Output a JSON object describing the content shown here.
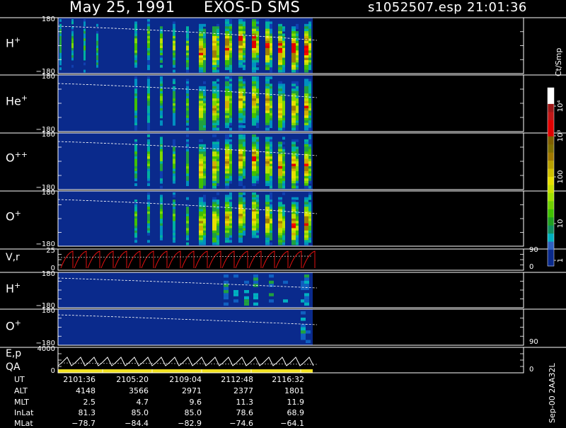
{
  "header": {
    "date": "May 25, 1991",
    "instrument": "EXOS-D SMS",
    "file": "s1052507.esp",
    "time": "21:01:36"
  },
  "chart_data": [
    {
      "type": "heatmap",
      "panel": "H+",
      "ion": "H",
      "charge": "+",
      "y_top": "180",
      "y_bottom": "−180",
      "rows": "energy-angle spectrogram",
      "color_scale": "log Ct/Smp"
    },
    {
      "type": "heatmap",
      "panel": "He+",
      "ion": "He",
      "charge": "+",
      "y_top": "180",
      "y_bottom": "−180"
    },
    {
      "type": "heatmap",
      "panel": "O++",
      "ion": "O",
      "charge": "++",
      "y_top": "180",
      "y_bottom": "−180"
    },
    {
      "type": "heatmap",
      "panel": "O+",
      "ion": "O",
      "charge": "+",
      "y_top": "180",
      "y_bottom": "−180"
    },
    {
      "type": "line",
      "panel": "V,r",
      "label": "V,r",
      "y_top": "25",
      "y_bottom": "0",
      "right_top": "90",
      "right_bottom": "0"
    },
    {
      "type": "heatmap",
      "panel": "H+ (lower)",
      "ion": "H",
      "charge": "+",
      "y_top": "180",
      "y_bottom": "−180"
    },
    {
      "type": "heatmap",
      "panel": "O+ (lower)",
      "ion": "O",
      "charge": "+",
      "y_top": "180",
      "y_bottom": "−180",
      "right_bottom": "90"
    },
    {
      "type": "line",
      "panel": "E,p QA",
      "label_1": "E,p",
      "label_2": "QA",
      "y_top": "4000",
      "y_bottom": "0",
      "right_bottom": "0"
    }
  ],
  "colorbar": {
    "title": "Ct/Smp",
    "ticks": [
      "10⁴",
      "10³",
      "100",
      "10",
      "1"
    ],
    "colors": [
      "#ffffff",
      "#ffffff",
      "#a01818",
      "#c01818",
      "#e00000",
      "#e00000",
      "#806000",
      "#807000",
      "#a07800",
      "#b8a000",
      "#d0c000",
      "#e8e000",
      "#c8e000",
      "#a0e000",
      "#70d000",
      "#40c000",
      "#20a020",
      "#109060",
      "#00b0c0",
      "#3060c0",
      "#0a2a8c",
      "#0a2a8c"
    ]
  },
  "ephemeris": {
    "labels": [
      "UT",
      "ALT",
      "MLT",
      "InLat",
      "MLat"
    ],
    "columns": [
      [
        "2101:36",
        "4148",
        "2.5",
        "81.3",
        "−78.7"
      ],
      [
        "2105:20",
        "3566",
        "4.7",
        "85.0",
        "−84.4"
      ],
      [
        "2109:04",
        "2971",
        "9.6",
        "85.0",
        "−82.9"
      ],
      [
        "2112:48",
        "2377",
        "11.3",
        "78.6",
        "−74.6"
      ],
      [
        "2116:32",
        "1801",
        "11.9",
        "68.9",
        "−64.1"
      ]
    ]
  },
  "footer_vertical": "Sep-00  2AA32L"
}
